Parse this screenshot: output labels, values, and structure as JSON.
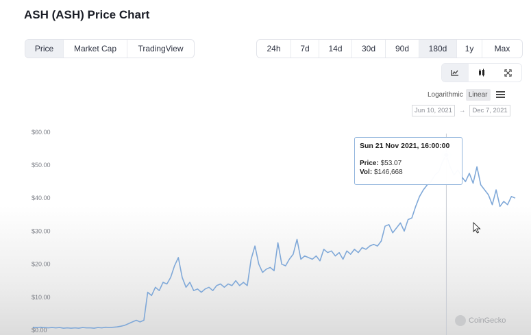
{
  "header": {
    "title": "ASH (ASH) Price Chart"
  },
  "metric_tabs": [
    {
      "label": "Price",
      "active": true
    },
    {
      "label": "Market Cap",
      "active": false
    },
    {
      "label": "TradingView",
      "active": false
    }
  ],
  "range_tabs": [
    {
      "label": "24h",
      "active": false
    },
    {
      "label": "7d",
      "active": false
    },
    {
      "label": "14d",
      "active": false
    },
    {
      "label": "30d",
      "active": false
    },
    {
      "label": "90d",
      "active": false
    },
    {
      "label": "180d",
      "active": true
    },
    {
      "label": "1y",
      "active": false
    },
    {
      "label": "Max",
      "active": false
    }
  ],
  "tools": [
    {
      "icon": "line-chart-icon",
      "active": true
    },
    {
      "icon": "candlestick-icon",
      "active": false
    },
    {
      "icon": "fullscreen-icon",
      "active": false
    }
  ],
  "scale": {
    "log_label": "Logarithmic",
    "linear_label": "Linear",
    "active": "Linear"
  },
  "date_range": {
    "from": "Jun 10, 2021",
    "arrow": "→",
    "to": "Dec 7, 2021"
  },
  "tooltip": {
    "title": "Sun 21 Nov 2021, 16:00:00",
    "price_label": "Price:",
    "price_value": "$53.07",
    "vol_label": "Vol:",
    "vol_value": "$146,668"
  },
  "watermark": "CoinGecko",
  "colors": {
    "line": "#7fa8d8",
    "accent": "#8fb3dc"
  },
  "chart_data": {
    "type": "line",
    "title": "ASH (ASH) Price Chart",
    "xlabel": "",
    "ylabel": "",
    "ylim": [
      0,
      62
    ],
    "y_ticks": [
      "$0.00",
      "$10.00",
      "$20.00",
      "$30.00",
      "$40.00",
      "$50.00",
      "$60.00"
    ],
    "x_range": [
      "2021-06-10",
      "2021-12-07"
    ],
    "highlight": {
      "date": "2021-11-21",
      "value": 53.07
    },
    "series": [
      {
        "values": [
          0.9,
          0.8,
          0.9,
          0.8,
          0.7,
          0.8,
          0.7,
          0.8,
          0.6,
          0.7,
          0.6,
          0.7,
          0.6,
          0.8,
          0.7,
          0.7,
          0.6,
          0.8,
          0.7,
          0.9,
          0.8,
          0.9,
          1.0,
          1.2,
          1.5,
          2.0,
          2.5,
          3.0,
          2.5,
          3.0,
          11.5,
          10.5,
          13.0,
          12.0,
          14.5,
          14.0,
          16.0,
          19.5,
          22.0,
          16.0,
          13.0,
          14.5,
          12.0,
          12.5,
          11.5,
          12.5,
          13.0,
          12.0,
          13.5,
          14.0,
          13.0,
          14.0,
          13.5,
          15.0,
          13.5,
          14.5,
          13.5,
          21.5,
          25.5,
          20.0,
          17.5,
          18.5,
          19.0,
          18.0,
          26.5,
          20.0,
          19.5,
          21.5,
          23.0,
          27.5,
          21.5,
          22.5,
          22.0,
          21.5,
          22.5,
          21.0,
          24.5,
          23.5,
          24.0,
          22.5,
          23.5,
          21.5,
          24.0,
          23.0,
          24.5,
          23.5,
          25.0,
          24.5,
          25.5,
          26.0,
          25.5,
          27.0,
          31.5,
          32.0,
          29.5,
          31.0,
          32.5,
          30.0,
          33.5,
          34.0,
          37.5,
          40.5,
          42.5,
          44.0,
          45.0,
          47.0,
          48.0,
          51.0,
          53.07,
          49.5,
          47.0,
          48.5,
          46.5,
          45.0,
          47.5,
          44.5,
          49.5,
          44.0,
          42.5,
          41.0,
          38.0,
          42.5,
          37.5,
          39.0,
          38.0,
          40.5,
          40.0
        ]
      }
    ]
  }
}
